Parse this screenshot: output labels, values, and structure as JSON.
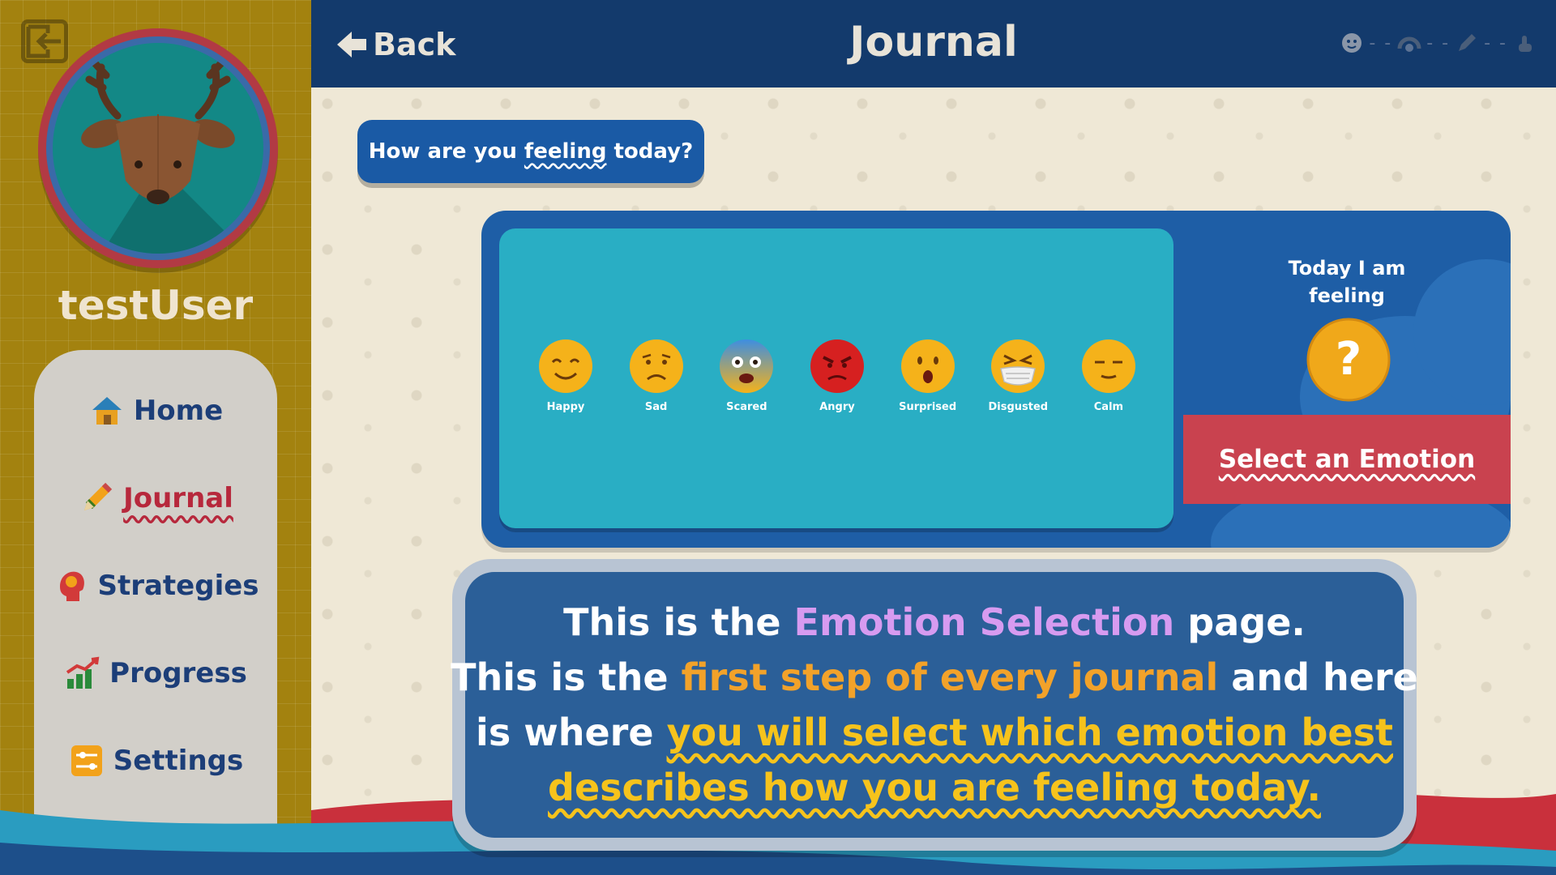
{
  "sidebar": {
    "username": "testUser",
    "nav": [
      {
        "label": "Home",
        "icon": "house-icon"
      },
      {
        "label": "Journal",
        "icon": "pencil-icon",
        "active": true
      },
      {
        "label": "Strategies",
        "icon": "head-icon"
      },
      {
        "label": "Progress",
        "icon": "chart-icon"
      },
      {
        "label": "Settings",
        "icon": "sliders-icon"
      }
    ]
  },
  "topbar": {
    "back_label": "Back",
    "title": "Journal"
  },
  "question": {
    "prefix": "How are you ",
    "emphasis": "feeling",
    "suffix": " today?"
  },
  "emotions": [
    {
      "label": "Happy",
      "color": "#f5b21a"
    },
    {
      "label": "Sad",
      "color": "#f5b21a"
    },
    {
      "label": "Scared",
      "color": "#4a9de0"
    },
    {
      "label": "Angry",
      "color": "#d62020"
    },
    {
      "label": "Surprised",
      "color": "#f5b21a"
    },
    {
      "label": "Disgusted",
      "color": "#f5b21a"
    },
    {
      "label": "Calm",
      "color": "#f5b21a"
    }
  ],
  "today": {
    "line1": "Today I am",
    "line2": "feeling",
    "select_label": "Select an Emotion"
  },
  "tutorial": {
    "l1_a": "This is the ",
    "l1_hl": "Emotion Selection",
    "l1_b": " page.",
    "l2_a": "This is the ",
    "l2_hl": "first step of every journal",
    "l2_b": " and here",
    "l3_a": "is where ",
    "l3_hl": "you will select which emotion best",
    "l4_hl": "describes how you are feeling today."
  },
  "colors": {
    "sidebar_bg": "#a3820f",
    "topbar_bg": "#133a6c",
    "card_bg": "#1e5ea6",
    "emotion_panel_bg": "#29aec4",
    "select_bar_bg": "#c9424f",
    "active_nav": "#b7283c"
  }
}
